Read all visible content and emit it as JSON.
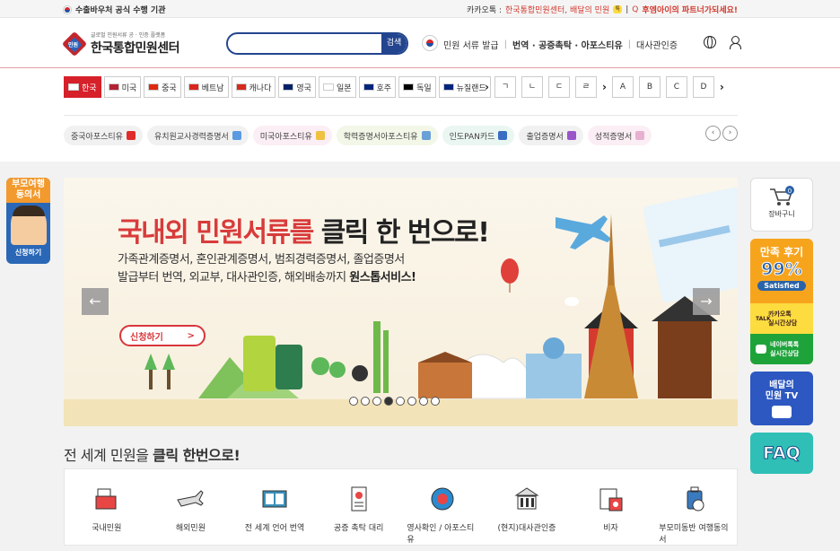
{
  "topbar": {
    "left_text": "수출바우처 공식 수행 기관",
    "kakao_prefix": "카카오톡 :",
    "kakao_text": "한국통합민원센터, 배달의 민원",
    "kakao_badge": "톡",
    "partner_prefix": "|",
    "partner_text": "후엠아이의 파트너가되세요!"
  },
  "header": {
    "logo_sub": "글로벌 민원서류 공 · 인증 플랫폼",
    "logo_main": "한국통합민원센터",
    "logo_badge": "민원",
    "search_placeholder": "",
    "search_button": "검색",
    "nav": [
      "민원 서류 발급",
      "번역 · 공증촉탁 · 아포스티유",
      "대사관인증"
    ]
  },
  "countries": [
    {
      "label": "한국",
      "active": true,
      "flag": "#ffffff"
    },
    {
      "label": "미국",
      "active": false,
      "flag": "#b22234"
    },
    {
      "label": "중국",
      "active": false,
      "flag": "#de2910"
    },
    {
      "label": "베트남",
      "active": false,
      "flag": "#da251d"
    },
    {
      "label": "캐나다",
      "active": false,
      "flag": "#d52b1e"
    },
    {
      "label": "영국",
      "active": false,
      "flag": "#012169"
    },
    {
      "label": "일본",
      "active": false,
      "flag": "#ffffff"
    },
    {
      "label": "호주",
      "active": false,
      "flag": "#00247d"
    },
    {
      "label": "독일",
      "active": false,
      "flag": "#000000"
    },
    {
      "label": "뉴질랜드",
      "active": false,
      "flag": "#00247d"
    }
  ],
  "letters": [
    "ㄱ",
    "ㄴ",
    "ㄷ",
    "ㄹ",
    "A",
    "B",
    "C",
    "D"
  ],
  "pills": [
    {
      "label": "중국아포스티유",
      "style": "",
      "icon": "#e02b2b"
    },
    {
      "label": "유치원교사경력증명서",
      "style": "",
      "icon": "#5b9ae0"
    },
    {
      "label": "미국아포스티유",
      "style": "pink",
      "icon": "#f0c040"
    },
    {
      "label": "학력증명서아포스티유",
      "style": "green",
      "icon": "#6aa0d8"
    },
    {
      "label": "인도PAN카드",
      "style": "mint",
      "icon": "#3a6cc4"
    },
    {
      "label": "출업증명서",
      "style": "",
      "icon": "#9a56c8"
    },
    {
      "label": "성적증명서",
      "style": "pink",
      "icon": "#e8b0d0"
    }
  ],
  "side_left": {
    "title": "부모여행동의서",
    "button": "신청하기"
  },
  "banner": {
    "headline_red": "국내외 민원서류를",
    "headline_dark": "클릭 한 번으로!",
    "line1": "가족관계증명서, 혼인관계증명서, 범죄경력증명서, 졸업증명서",
    "line2_pre": "발급부터 번역, 외교부, 대사관인증, 해외배송까지",
    "line2_bold": "원스톱서비스!",
    "apply_label": "신청하기",
    "apply_arrow": ">",
    "prev": "←",
    "next": "→",
    "slides": 8,
    "active_slide": 4
  },
  "section_title_pre": "전 세계 민원을",
  "section_title_bold": "클릭 한번으로!",
  "services": [
    {
      "label": "국내민원",
      "icon": "folder-icon"
    },
    {
      "label": "해외민원",
      "icon": "airplane-icon"
    },
    {
      "label": "전 세계 언어 번역",
      "icon": "book-icon"
    },
    {
      "label": "공증 촉탁 대리",
      "icon": "id-document-icon"
    },
    {
      "label": "영사확인 / 아포스티유",
      "icon": "badge-icon"
    },
    {
      "label": "(현지)대사관인증",
      "icon": "embassy-icon"
    },
    {
      "label": "비자",
      "icon": "visa-icon"
    },
    {
      "label": "부모미동반 여행동의서",
      "icon": "luggage-icon"
    }
  ],
  "right_side": {
    "cart_label": "장바구니",
    "cart_count": "0",
    "review_title": "만족 후기",
    "review_percent": "99%",
    "review_sub": "Satisfied",
    "kakao_line1": "카카오톡",
    "kakao_line2": "실시간상담",
    "naver_line1": "네이버톡톡",
    "naver_line2": "실시간상담",
    "tv_line1": "배달의",
    "tv_line2": "민원 TV",
    "faq": "FAQ"
  }
}
